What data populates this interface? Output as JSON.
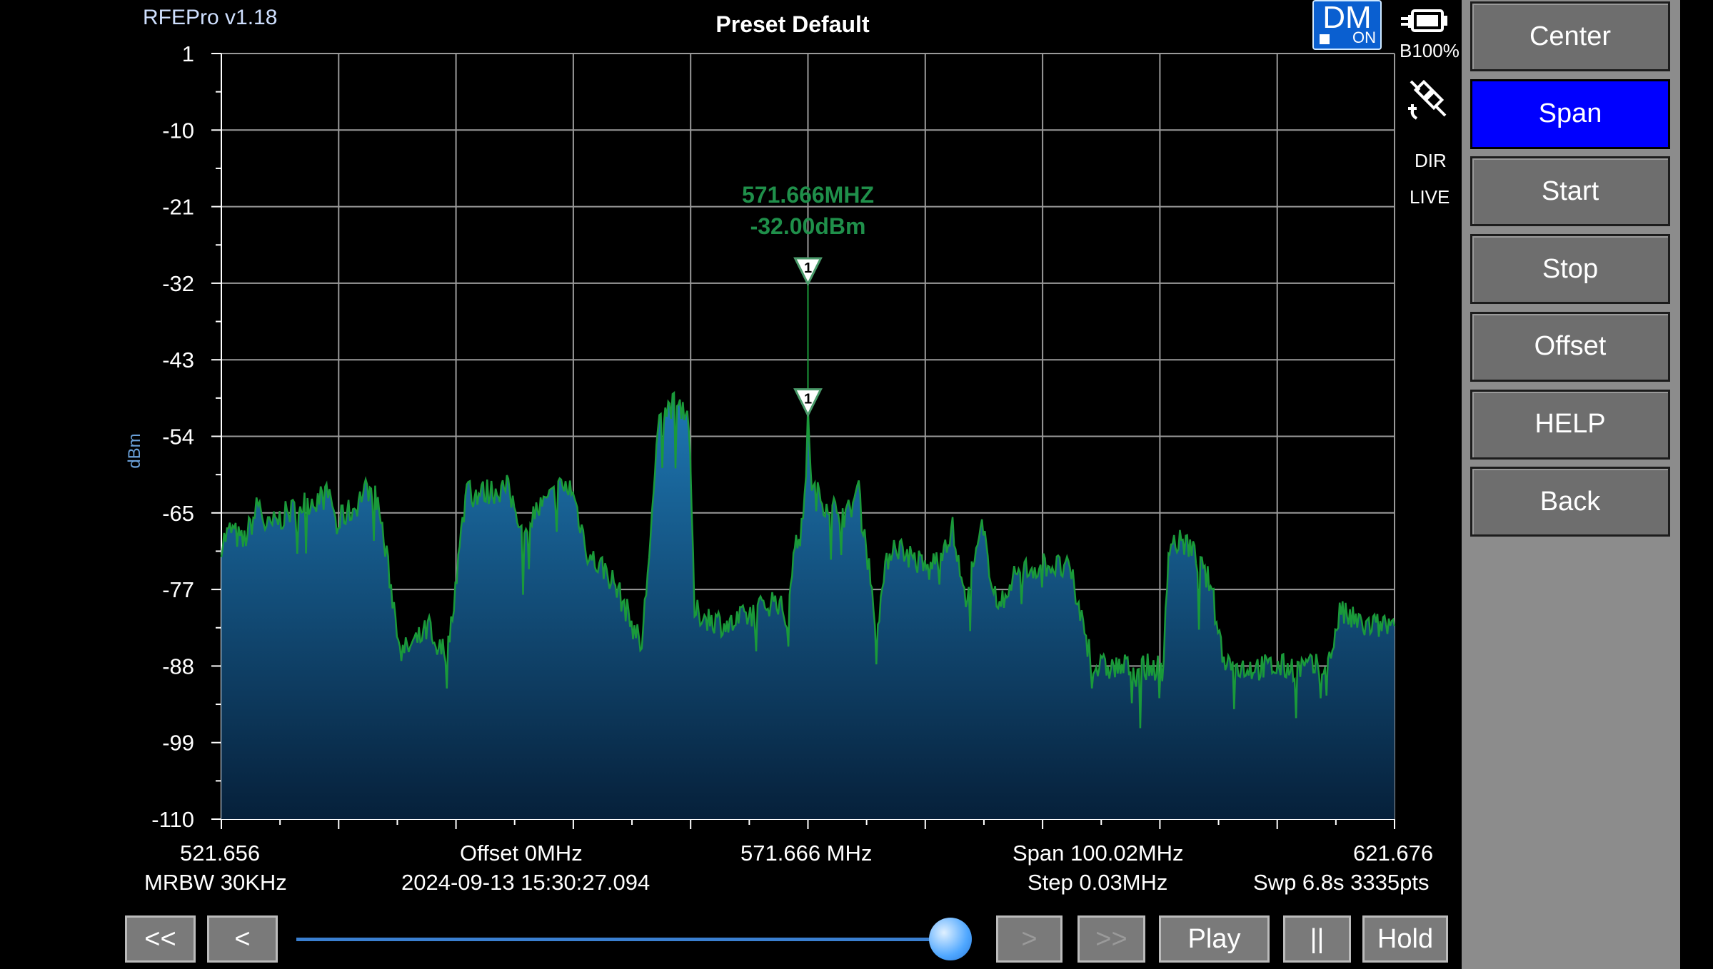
{
  "app": {
    "title": "RFEPro v1.18",
    "preset": "Preset Default"
  },
  "status": {
    "dm_top": "DM",
    "dm_bottom": "ON",
    "battery": "B100%",
    "dir": "DIR",
    "live": "LIVE"
  },
  "menu": {
    "items": [
      "Center",
      "Span",
      "Start",
      "Stop",
      "Offset",
      "HELP",
      "Back"
    ],
    "active": "Span"
  },
  "info": {
    "start_freq": "521.656",
    "center_freq": "571.666 MHz",
    "stop_freq": "621.676",
    "offset": "Offset 0MHz",
    "span": "Span 100.02MHz",
    "rbw": "MRBW 30KHz",
    "timestamp": "2024-09-13 15:30:27.094",
    "step": "Step 0.03MHz",
    "sweep": "Swp 6.8s  3335pts"
  },
  "controls": {
    "rewind_label": "<<",
    "back_label": "<",
    "forward_label": ">",
    "fast_forward_label": ">>",
    "play_label": "Play",
    "pause_label": "||",
    "hold_label": "Hold",
    "playback_position": 0.98
  },
  "marker": {
    "id": "1",
    "freq_label": "571.666MHZ",
    "level_label": "-32.00dBm",
    "freq": 571.666,
    "level": -32,
    "trace_level": -51
  },
  "colors": {
    "trace": "#1a9a3a",
    "fill_top": "#1e78b4",
    "fill_bottom": "#06203a",
    "marker_text": "#1f8f4a",
    "menu_active": "#0000ff",
    "menu_bg": "#8c8c8c"
  },
  "chart_data": {
    "type": "area",
    "title": "Preset Default",
    "xlabel": "",
    "ylabel": "dBm",
    "xlim": [
      521.656,
      621.676
    ],
    "ylim": [
      -110,
      1
    ],
    "yticks": [
      "1",
      "-10",
      "-21",
      "-32",
      "-43",
      "-54",
      "-65",
      "-77",
      "-88",
      "-99",
      "-110"
    ],
    "grid": true,
    "series": [
      {
        "x": [
          521.656,
          522.5,
          523.5,
          524.5,
          524.8,
          525.5,
          527.0,
          529.0,
          531.0,
          531.5,
          532.0,
          533.0,
          533.6,
          534.2,
          535.0,
          537.0,
          538.5,
          539.5,
          539.7,
          541.0,
          542.7,
          543.0,
          546.0,
          547.0,
          547.5,
          548.0,
          549.5,
          550.5,
          551.5,
          553.0,
          554.5,
          555.5,
          557.5,
          559.0,
          560.0,
          561.0,
          561.5,
          562.0,
          565.0,
          567.0,
          569.0,
          570.0,
          570.2,
          571.0,
          571.5,
          571.666,
          572.0,
          573.0,
          575.0,
          576.0,
          577.5,
          578.5,
          579.0,
          580.5,
          582.0,
          584.0,
          585.0,
          586.0,
          586.5,
          588.0,
          589.0,
          590.0,
          592.0,
          594.0,
          596.0,
          597.0,
          600.0,
          602.0,
          602.3,
          602.5,
          604.0,
          606.0,
          607.0,
          608.0,
          609.0,
          611.0,
          614.0,
          616.0,
          617.0,
          619.0,
          621.676
        ],
        "y": [
          -70,
          -68,
          -70,
          -66,
          -64,
          -68,
          -66,
          -64,
          -63,
          -68,
          -66,
          -65,
          -63,
          -62,
          -64,
          -86,
          -84,
          -82,
          -86,
          -85,
          -60,
          -63,
          -62,
          -66,
          -70,
          -66,
          -64,
          -62,
          -62,
          -72,
          -74,
          -77,
          -85,
          -52,
          -50,
          -50,
          -52,
          -80,
          -82,
          -80,
          -78,
          -82,
          -74,
          -68,
          -62,
          -51,
          -62,
          -64,
          -66,
          -62,
          -82,
          -72,
          -70,
          -72,
          -74,
          -68,
          -78,
          -72,
          -68,
          -80,
          -75,
          -74,
          -73,
          -74,
          -88,
          -88,
          -88,
          -88,
          -74,
          -70,
          -70,
          -76,
          -86,
          -88,
          -88,
          -88,
          -88,
          -88,
          -80,
          -82,
          -82
        ]
      }
    ]
  }
}
